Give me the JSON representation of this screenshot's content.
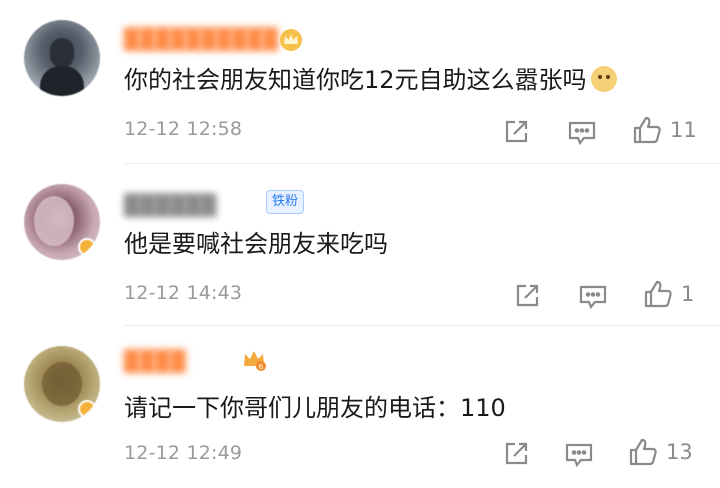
{
  "colors": {
    "text": "#1a1a1a",
    "meta": "#9a9a9a",
    "icon": "#8a8a8a",
    "fan_badge": "#2f7bf0"
  },
  "comments": [
    {
      "username": "██████████",
      "username_color": "orange",
      "badge_icon": "crown-icon",
      "text": "你的社会朋友知道你吃12元自助这么嚣张吗",
      "emoji": "doge-emoji-icon",
      "time": "12-12 12:58",
      "likes": "11"
    },
    {
      "username": "██████",
      "username_color": "gray",
      "badge": "铁粉",
      "text": "他是要喊社会朋友来吃吗",
      "time": "12-12 14:43",
      "likes": "1"
    },
    {
      "username": "████",
      "username_color": "orange",
      "badge_icon": "vip-crown-icon",
      "badge_icon_text": "6",
      "text": "请记一下你哥们儿朋友的电话：110",
      "time": "12-12 12:49",
      "likes": "13"
    }
  ]
}
